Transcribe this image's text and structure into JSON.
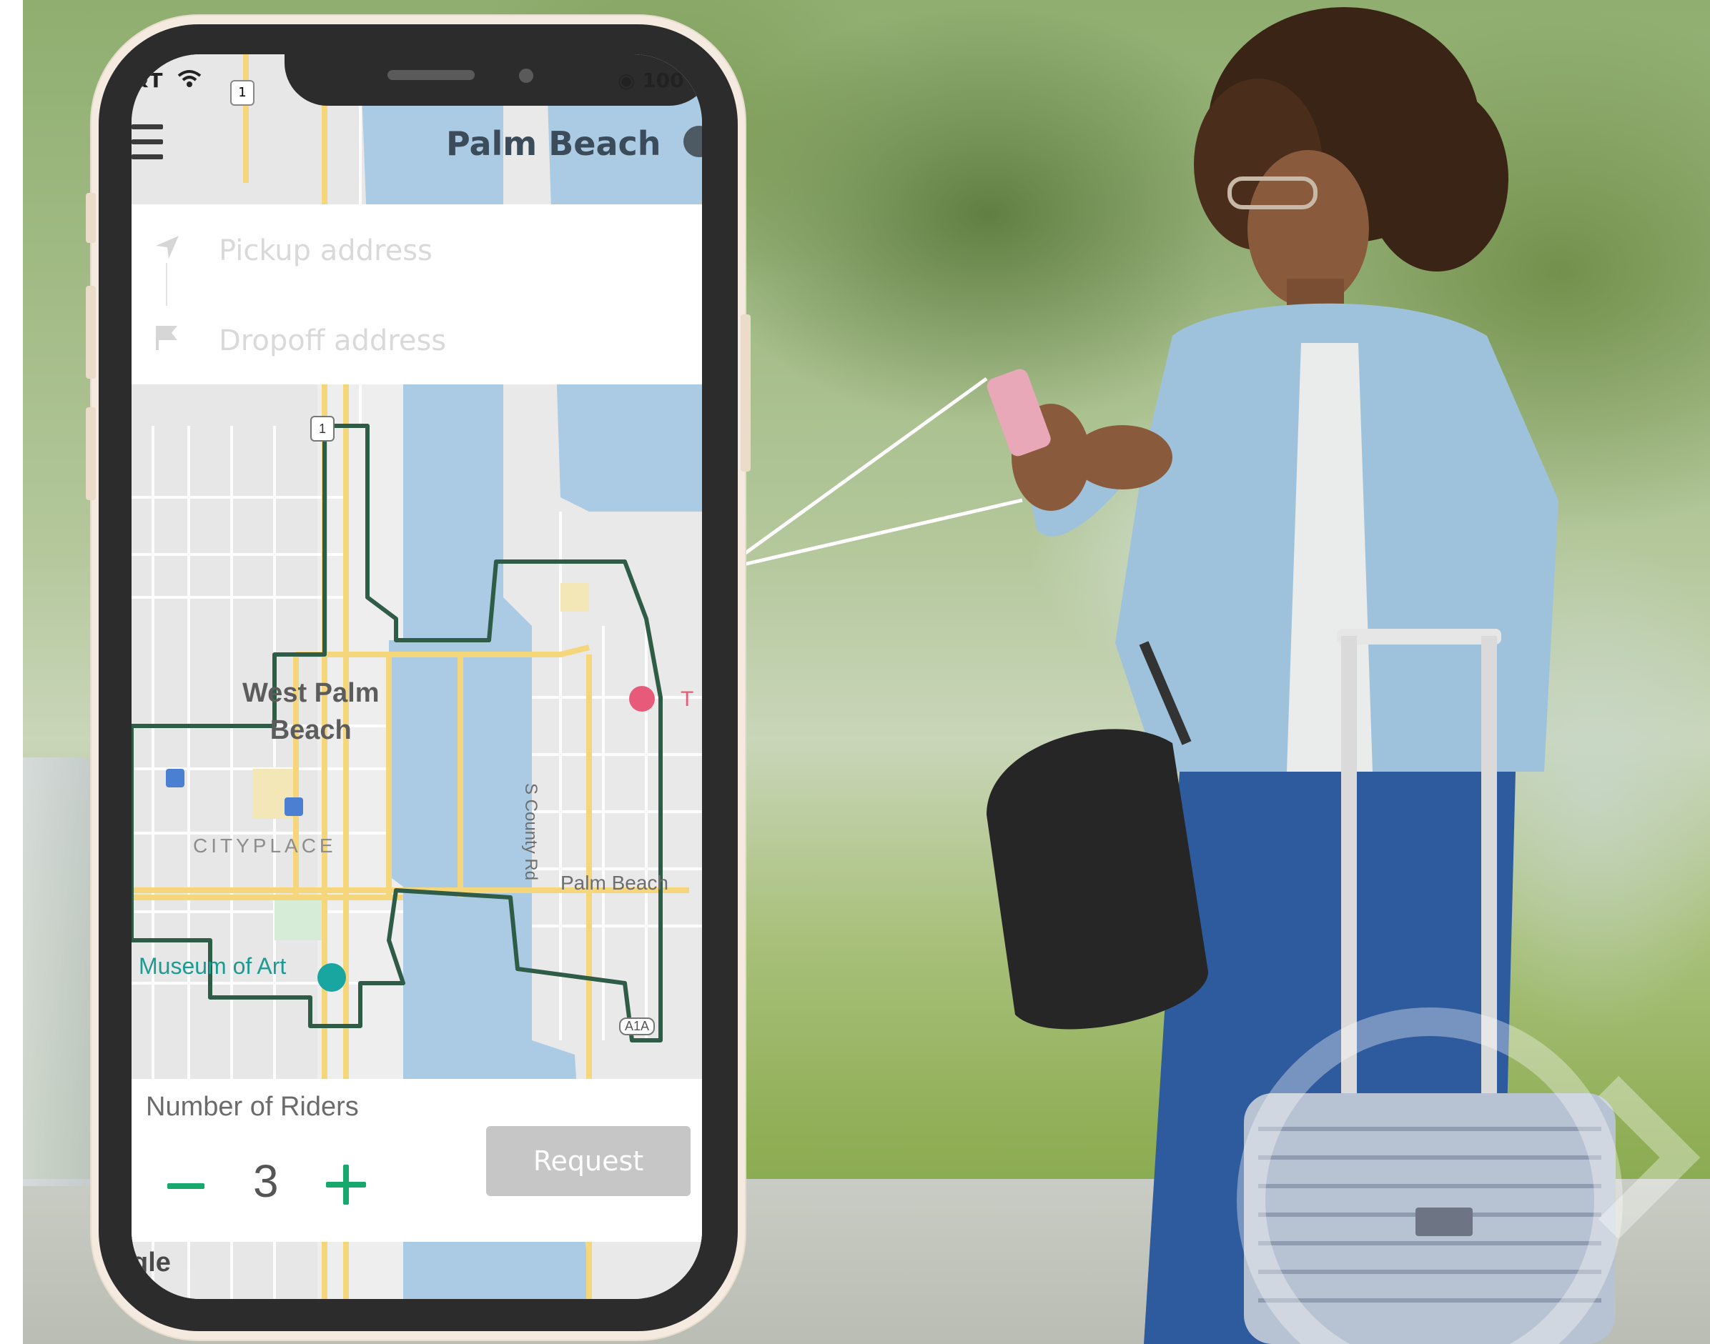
{
  "status_bar": {
    "carrier": "&T",
    "battery": "100"
  },
  "header": {
    "title": "Palm Beach",
    "menu_icon": "hamburger-menu-icon",
    "profile_icon": "user-avatar-icon"
  },
  "address": {
    "pickup_placeholder": "Pickup address",
    "dropoff_placeholder": "Dropoff address",
    "pickup_icon": "navigation-arrow-icon",
    "dropoff_icon": "flag-icon"
  },
  "map": {
    "labels": {
      "city_line1": "West Palm",
      "city_line2": "Beach",
      "district": "CITYPLACE",
      "town": "Palm Beach",
      "museum": "Museum of Art",
      "road_county": "S County Rd",
      "poi_partial": "T",
      "road_a1a": "A1A",
      "route_1": "1",
      "route_1_top": "1"
    },
    "colors": {
      "water": "#aacbe3",
      "land": "#ededed",
      "roads_major": "#f5d67a",
      "zone_border": "#2f5c46"
    }
  },
  "riders": {
    "label": "Number of Riders",
    "count": "3",
    "minus_label": "−",
    "plus_label": "+"
  },
  "request_button": {
    "label": "Request"
  },
  "attribution": "gle",
  "colors": {
    "accent": "#17a86e",
    "button_disabled": "#c6c6c6"
  }
}
